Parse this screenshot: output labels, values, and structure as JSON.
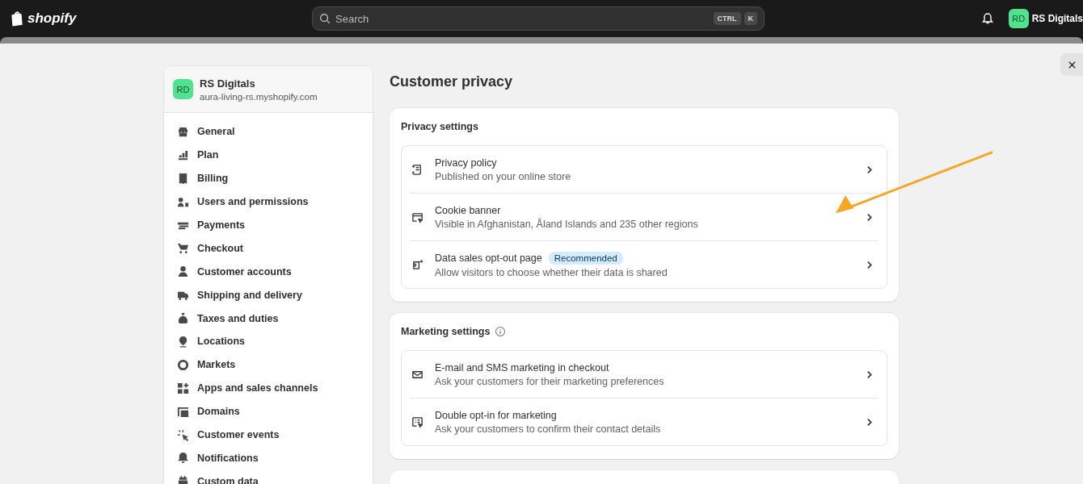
{
  "topbar": {
    "logo": "shopify",
    "search": {
      "placeholder": "Search",
      "keys": [
        "CTRL",
        "K"
      ]
    },
    "user": {
      "initials": "RD",
      "name": "RS Digitals"
    }
  },
  "sidebar": {
    "store": {
      "initials": "RD",
      "name": "RS Digitals",
      "domain": "aura-living-rs.myshopify.com"
    },
    "items": [
      {
        "label": "General"
      },
      {
        "label": "Plan"
      },
      {
        "label": "Billing"
      },
      {
        "label": "Users and permissions"
      },
      {
        "label": "Payments"
      },
      {
        "label": "Checkout"
      },
      {
        "label": "Customer accounts"
      },
      {
        "label": "Shipping and delivery"
      },
      {
        "label": "Taxes and duties"
      },
      {
        "label": "Locations"
      },
      {
        "label": "Markets"
      },
      {
        "label": "Apps and sales channels"
      },
      {
        "label": "Domains"
      },
      {
        "label": "Customer events"
      },
      {
        "label": "Notifications"
      },
      {
        "label": "Custom data"
      }
    ]
  },
  "page": {
    "title": "Customer privacy",
    "sections": [
      {
        "title": "Privacy settings",
        "info": false,
        "rows": [
          {
            "title": "Privacy policy",
            "subtitle": "Published on your online store"
          },
          {
            "title": "Cookie banner",
            "subtitle": "Visible in Afghanistan, Åland Islands and 235 other regions"
          },
          {
            "title": "Data sales opt-out page",
            "badge": "Recommended",
            "subtitle": "Allow visitors to choose whether their data is shared"
          }
        ]
      },
      {
        "title": "Marketing settings",
        "info": true,
        "rows": [
          {
            "title": "E-mail and SMS marketing in checkout",
            "subtitle": "Ask your customers for their marketing preferences"
          },
          {
            "title": "Double opt-in for marketing",
            "subtitle": "Ask your customers to confirm their contact details"
          }
        ]
      }
    ]
  }
}
